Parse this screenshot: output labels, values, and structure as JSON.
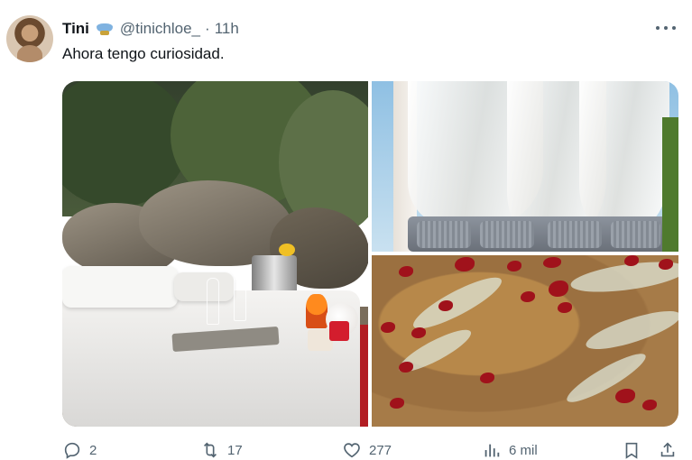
{
  "tweet": {
    "author": {
      "name": "Tini",
      "handle": "@tinichloe_",
      "separator": "·",
      "time": "11h"
    },
    "text": "Ahora tengo curiosidad.",
    "stats": {
      "replies": "2",
      "retweets": "17",
      "likes": "277",
      "views": "6 mil"
    }
  },
  "colors": {
    "text_primary": "#0f1419",
    "text_secondary": "#536471",
    "background": "#ffffff"
  }
}
